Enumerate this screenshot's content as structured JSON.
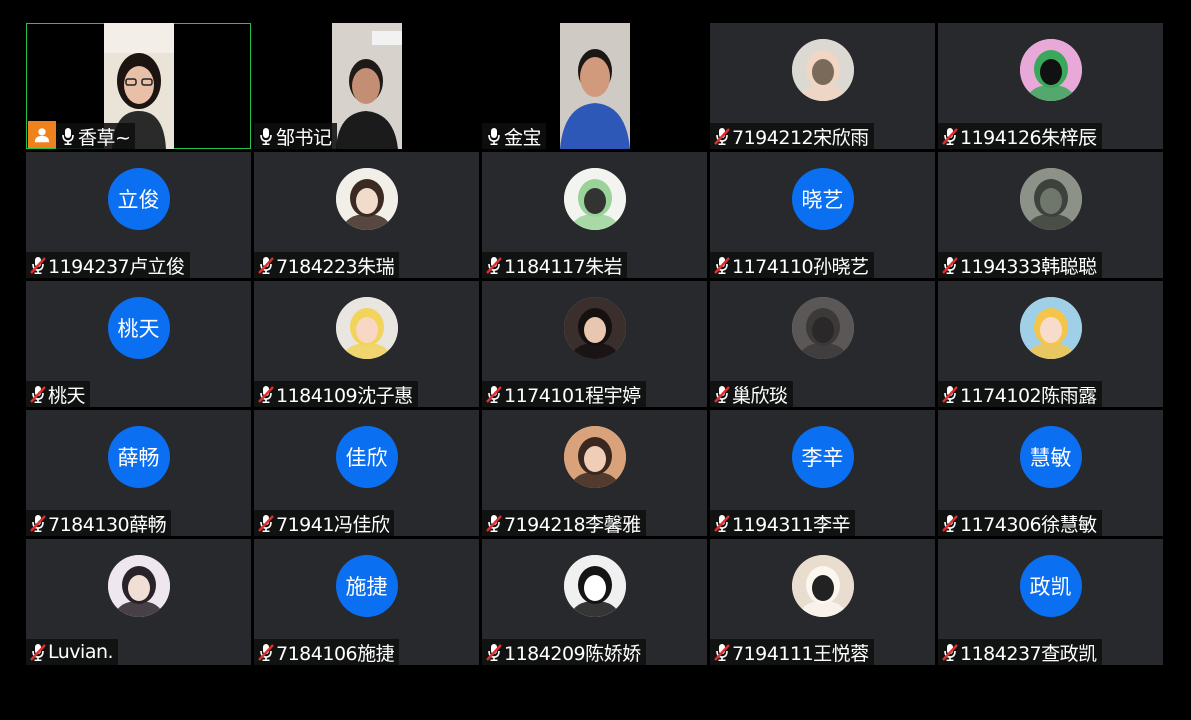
{
  "participants": [
    {
      "name": "香草~",
      "type": "video",
      "muted": false,
      "host": true,
      "speaking": true,
      "scene": "woman-glasses"
    },
    {
      "name": "邹书记",
      "type": "video",
      "muted": false,
      "host": false,
      "speaking": false,
      "scene": "man-older"
    },
    {
      "name": "金宝",
      "type": "video",
      "muted": false,
      "host": false,
      "speaking": false,
      "scene": "man-blue"
    },
    {
      "name": "7194212宋欣雨",
      "type": "avatar-image",
      "muted": true,
      "avatar": "baby-photo"
    },
    {
      "name": "1194126朱梓辰",
      "type": "avatar-image",
      "muted": true,
      "avatar": "dinosaur-sunglasses"
    },
    {
      "name": "1194237卢立俊",
      "type": "avatar-text",
      "muted": true,
      "avatar_text": "立俊"
    },
    {
      "name": "7184223朱瑞",
      "type": "avatar-image",
      "muted": true,
      "avatar": "girl-drawing"
    },
    {
      "name": "1184117朱岩",
      "type": "avatar-image",
      "muted": true,
      "avatar": "meme-face"
    },
    {
      "name": "1174110孙晓艺",
      "type": "avatar-text",
      "muted": true,
      "avatar_text": "晓艺"
    },
    {
      "name": "1194333韩聪聪",
      "type": "avatar-image",
      "muted": true,
      "avatar": "silhouette-landscape"
    },
    {
      "name": "桃天",
      "type": "avatar-text",
      "muted": true,
      "avatar_text": "桃天"
    },
    {
      "name": "1184109沈子惠",
      "type": "avatar-image",
      "muted": true,
      "avatar": "anime-blonde"
    },
    {
      "name": "1174101程宇婷",
      "type": "avatar-image",
      "muted": true,
      "avatar": "woman-dark-hair"
    },
    {
      "name": "巢欣琰",
      "type": "avatar-image",
      "muted": true,
      "avatar": "dusk-sky"
    },
    {
      "name": "1174102陈雨露",
      "type": "avatar-image",
      "muted": true,
      "avatar": "anime-red-bow"
    },
    {
      "name": "7184130薛畅",
      "type": "avatar-text",
      "muted": true,
      "avatar_text": "薛畅"
    },
    {
      "name": "71941冯佳欣",
      "type": "avatar-text",
      "muted": true,
      "avatar_text": "佳欣"
    },
    {
      "name": "7194218李馨雅",
      "type": "avatar-image",
      "muted": true,
      "avatar": "woman-smile"
    },
    {
      "name": "1194311李辛",
      "type": "avatar-text",
      "muted": true,
      "avatar_text": "李辛"
    },
    {
      "name": "1174306徐慧敏",
      "type": "avatar-text",
      "muted": true,
      "avatar_text": "慧敏"
    },
    {
      "name": "Luvian.",
      "type": "avatar-image",
      "muted": true,
      "avatar": "illustrated-girl"
    },
    {
      "name": "7184106施捷",
      "type": "avatar-text",
      "muted": true,
      "avatar_text": "施捷"
    },
    {
      "name": "1184209陈娇娇",
      "type": "avatar-image",
      "muted": true,
      "avatar": "puppy-black-white"
    },
    {
      "name": "7194111王悦蓉",
      "type": "avatar-image",
      "muted": true,
      "avatar": "white-poodle"
    },
    {
      "name": "1184237查政凯",
      "type": "avatar-text",
      "muted": true,
      "avatar_text": "政凯"
    }
  ],
  "colors": {
    "tile_bg": "#27292c",
    "avatar_blue": "#0b6ff2",
    "speaking_border": "#27c24a",
    "host_badge": "#f0821e",
    "muted_red": "#e02f2f"
  }
}
